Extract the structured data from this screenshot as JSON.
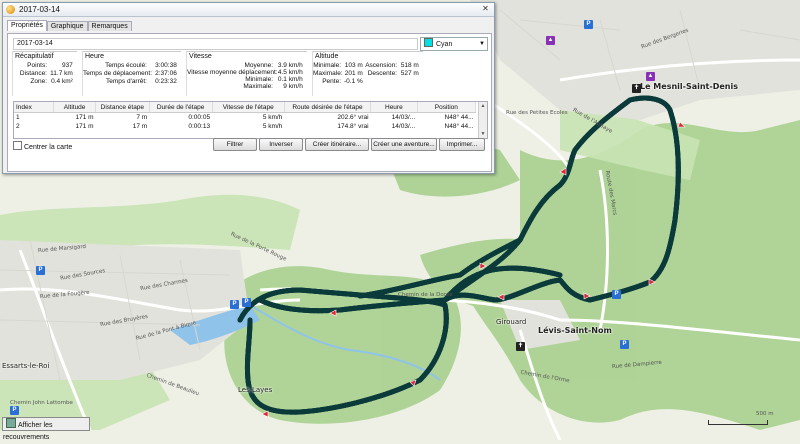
{
  "window": {
    "title": "2017-03-14",
    "close_label": "✕"
  },
  "tabs": [
    {
      "label": "Propriétés"
    },
    {
      "label": "Graphique"
    },
    {
      "label": "Remarques"
    }
  ],
  "track": {
    "name": "2017-03-14",
    "color_label": "Cyan",
    "color": "#00e0e0"
  },
  "summary": {
    "title": "Récapitulatif",
    "rows": [
      {
        "k": "Points:",
        "v": "937"
      },
      {
        "k": "Distance:",
        "v": "11.7 km"
      },
      {
        "k": "Zone:",
        "v": "0.4 km²"
      }
    ]
  },
  "time": {
    "title": "Heure",
    "rows": [
      {
        "k": "Temps écoulé:",
        "v": "3:00:38"
      },
      {
        "k": "Temps de déplacement:",
        "v": "2:37:06"
      },
      {
        "k": "Temps d'arrêt:",
        "v": "0:23:32"
      }
    ]
  },
  "speed": {
    "title": "Vitesse",
    "rows": [
      {
        "k": "Moyenne:",
        "v": "3.9 km/h"
      },
      {
        "k": "Vitesse moyenne déplacement:",
        "v": "4.5 km/h"
      },
      {
        "k": "Minimale:",
        "v": "0.1 km/h"
      },
      {
        "k": "Maximale:",
        "v": "9 km/h"
      }
    ]
  },
  "altitude": {
    "title": "Altitude",
    "rows": [
      {
        "k": "Minimale:",
        "v": "103 m"
      },
      {
        "k": "Maximale:",
        "v": "201 m"
      },
      {
        "k": "Pente:",
        "v": "-0.1 %"
      }
    ],
    "rows2": [
      {
        "k": "Ascension:",
        "v": "518 m"
      },
      {
        "k": "Descente:",
        "v": "527 m"
      }
    ]
  },
  "table": {
    "headers": [
      "Index",
      "Altitude",
      "Distance étape",
      "Durée de l'étape",
      "Vitesse de l'étape",
      "Route désirée de l'étape",
      "Heure",
      "Position"
    ],
    "rows": [
      [
        "1",
        "171 m",
        "7 m",
        "0:00:05",
        "5 km/h",
        "202.6° vrai",
        "14/03/...",
        "N48° 44..."
      ],
      [
        "2",
        "171 m",
        "17 m",
        "0:00:13",
        "5 km/h",
        "174.8° vrai",
        "14/03/...",
        "N48° 44..."
      ]
    ]
  },
  "bottom": {
    "center_map": "Centrer la carte",
    "filter": "Filtrer",
    "reverse": "Inverser",
    "create_route": "Créer itinéraire...",
    "create_adventure": "Créer une aventure...",
    "print": "Imprimer..."
  },
  "map": {
    "places": {
      "mesnil": "Le Mesnil-Saint-Denis",
      "levis": "Lévis-Saint-Nom",
      "girouard": "Girouard",
      "layes": "Les Layes",
      "essarts": "Essarts-le-Roi"
    },
    "streets": {
      "s1": "Rue de Marsigard",
      "s2": "Rue de la Porte Rouge",
      "s3": "Rue des Charmes",
      "s4": "Rue de la Fougère",
      "s5": "Rue des Bruyères",
      "s6": "Rue de la Pont à Bique",
      "s7": "Chemin de la Dorée",
      "s8": "Rue de Dampierre",
      "s9": "Chemin de Beaulieu",
      "s10": "Route des Marcs",
      "s11": "Rue des Sources",
      "s12": "Chemin John Lattombe",
      "s13": "Rue des Petites Ecoles",
      "s14": "Rue de l'Abbaye",
      "s15": "Chemin de l'Orme",
      "s16": "Rue des Bergeries"
    },
    "scale_label": "500 m",
    "overlay_button": "Afficher les recouvrements"
  }
}
